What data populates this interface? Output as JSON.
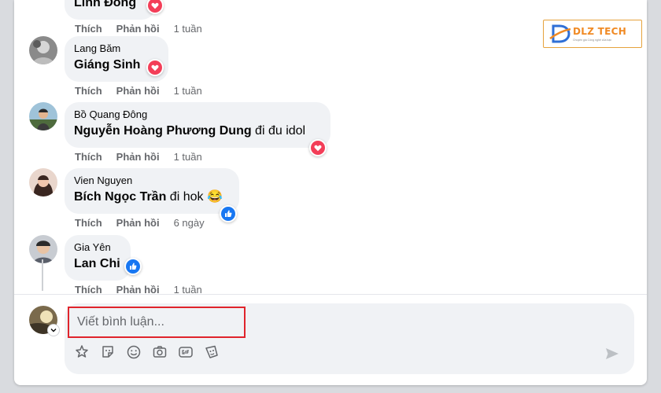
{
  "colors": {
    "panel_bg": "#ffffff",
    "bubble_bg": "#f0f2f5",
    "text_primary": "#050505",
    "text_secondary": "#65676b",
    "heart_red": "#f33e58",
    "like_blue": "#1877f2",
    "highlight_red": "#e0242c",
    "logo_orange": "#f08a24",
    "logo_blue": "#2f6fd6"
  },
  "logo": {
    "brand": "DLZ TECH",
    "tagline": "Chuyên gia Công nghệ của bạn"
  },
  "top_partial": {
    "body": "Linh Đồng",
    "reaction": "heart-icon",
    "actions": {
      "like": "Thích",
      "reply": "Phản hồi",
      "time": "1 tuần"
    }
  },
  "comments": [
    {
      "author": "Lang Băm",
      "mention": "Giáng Sinh",
      "text": "",
      "reaction": "heart-icon",
      "actions": {
        "like": "Thích",
        "reply": "Phản hồi",
        "time": "1 tuần"
      }
    },
    {
      "author": "Bồ Quang Đông",
      "mention": "Nguyễn Hoàng Phương Dung",
      "text": " đi đu idol",
      "reaction": "heart-icon",
      "actions": {
        "like": "Thích",
        "reply": "Phản hồi",
        "time": "1 tuần"
      }
    },
    {
      "author": "Vien Nguyen",
      "mention": "Bích Ngọc Trần",
      "text": " đi hok 😂",
      "reaction": "like-icon",
      "actions": {
        "like": "Thích",
        "reply": "Phản hồi",
        "time": "6 ngày"
      }
    },
    {
      "author": "Gia Yên",
      "mention": "Lan Chi",
      "text": "",
      "reaction": "like-icon",
      "actions": {
        "like": "Thích",
        "reply": "Phản hồi",
        "time": "1 tuần"
      }
    }
  ],
  "composer": {
    "placeholder": "Viết bình luận...",
    "value": "",
    "tools": [
      "avatar-sticker-icon",
      "sticker-icon",
      "emoji-icon",
      "camera-icon",
      "gif-icon",
      "sticker-pack-icon"
    ],
    "send_icon": "send-icon"
  }
}
